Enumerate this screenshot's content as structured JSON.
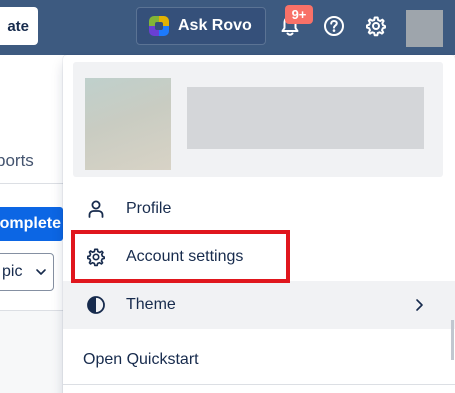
{
  "topbar": {
    "create_label": "ate",
    "rovo_label": "Ask Rovo",
    "notifications_badge": "9+",
    "icons": [
      "bell-icon",
      "help-icon",
      "gear-icon"
    ],
    "bg_color": "#3d5a80"
  },
  "background": {
    "tab_text": "ports",
    "primary_button": "omplete",
    "select_value": "pic"
  },
  "menu": {
    "items": [
      {
        "label": "Profile",
        "icon": "person-icon"
      },
      {
        "label": "Account settings",
        "icon": "gear-icon"
      },
      {
        "label": "Theme",
        "icon": "theme-icon",
        "has_submenu": true
      },
      {
        "label": "Open Quickstart"
      }
    ]
  },
  "colors": {
    "accent": "#0c66e4",
    "badge": "#f87168",
    "highlight": "#e0161d"
  }
}
